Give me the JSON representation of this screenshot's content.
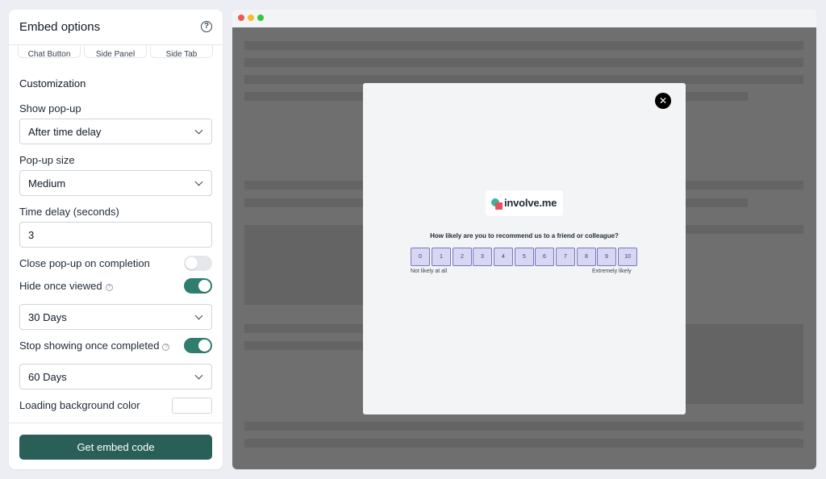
{
  "panel": {
    "title": "Embed options",
    "embed_types": [
      "Chat Button",
      "Side Panel",
      "Side Tab"
    ],
    "customization_title": "Customization",
    "show_popup": {
      "label": "Show pop-up",
      "value": "After time delay"
    },
    "popup_size": {
      "label": "Pop-up size",
      "value": "Medium"
    },
    "time_delay": {
      "label": "Time delay (seconds)",
      "value": "3"
    },
    "close_on_completion": {
      "label": "Close pop-up on completion",
      "enabled": false
    },
    "hide_once_viewed": {
      "label": "Hide once viewed",
      "enabled": true,
      "duration": "30 Days"
    },
    "stop_once_completed": {
      "label": "Stop showing once completed",
      "enabled": true,
      "duration": "60 Days"
    },
    "loading_bg": {
      "label": "Loading background color",
      "value": "#ffffff"
    },
    "embed_button": "Get embed code"
  },
  "colors": {
    "accent": "#2a5f57",
    "toggle_on": "#2f7d6f",
    "score_fill": "#d8d7f2",
    "score_border": "#7a74c9"
  },
  "preview": {
    "window_dots": [
      "#ee5a52",
      "#f5bd2f",
      "#2fc840"
    ],
    "modal": {
      "close_icon": "close-icon",
      "logo_text": "involve.me",
      "question": "How likely are you to recommend us to a friend or colleague?",
      "scores": [
        "0",
        "1",
        "2",
        "3",
        "4",
        "5",
        "6",
        "7",
        "8",
        "9",
        "10"
      ],
      "low_label": "Not likely at all",
      "high_label": "Extremely likely"
    }
  }
}
